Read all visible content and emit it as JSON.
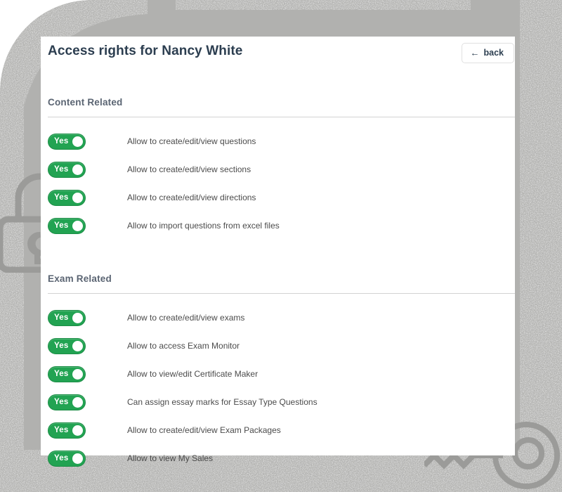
{
  "page": {
    "title": "Access rights for Nancy White"
  },
  "back_button": {
    "label": "back",
    "icon": "arrow-left-icon",
    "glyph": "←"
  },
  "toggle": {
    "on_label": "Yes"
  },
  "colors": {
    "toggle_on": "#22a352",
    "toggle_on_border": "#1c8e46",
    "title": "#2c3e50",
    "section_title": "#5a6472",
    "label": "#4b4b4b",
    "backdrop": "#b1b1af",
    "card": "#ffffff",
    "rule": "#d3d3d3"
  },
  "sections": [
    {
      "title": "Content Related",
      "permissions": [
        {
          "label": "Allow to create/edit/view questions",
          "state": "Yes"
        },
        {
          "label": "Allow to create/edit/view sections",
          "state": "Yes"
        },
        {
          "label": "Allow to create/edit/view directions",
          "state": "Yes"
        },
        {
          "label": "Allow to import questions from excel files",
          "state": "Yes"
        }
      ]
    },
    {
      "title": "Exam Related",
      "permissions": [
        {
          "label": "Allow to create/edit/view exams",
          "state": "Yes"
        },
        {
          "label": "Allow to access Exam Monitor",
          "state": "Yes"
        },
        {
          "label": "Allow to view/edit Certificate Maker",
          "state": "Yes"
        },
        {
          "label": "Can assign essay marks for Essay Type Questions",
          "state": "Yes"
        },
        {
          "label": "Allow to create/edit/view Exam Packages",
          "state": "Yes"
        },
        {
          "label": "Allow to view My Sales",
          "state": "Yes"
        }
      ]
    }
  ],
  "watermarks": [
    {
      "name": "padlock-watermark"
    },
    {
      "name": "key-watermark"
    }
  ]
}
